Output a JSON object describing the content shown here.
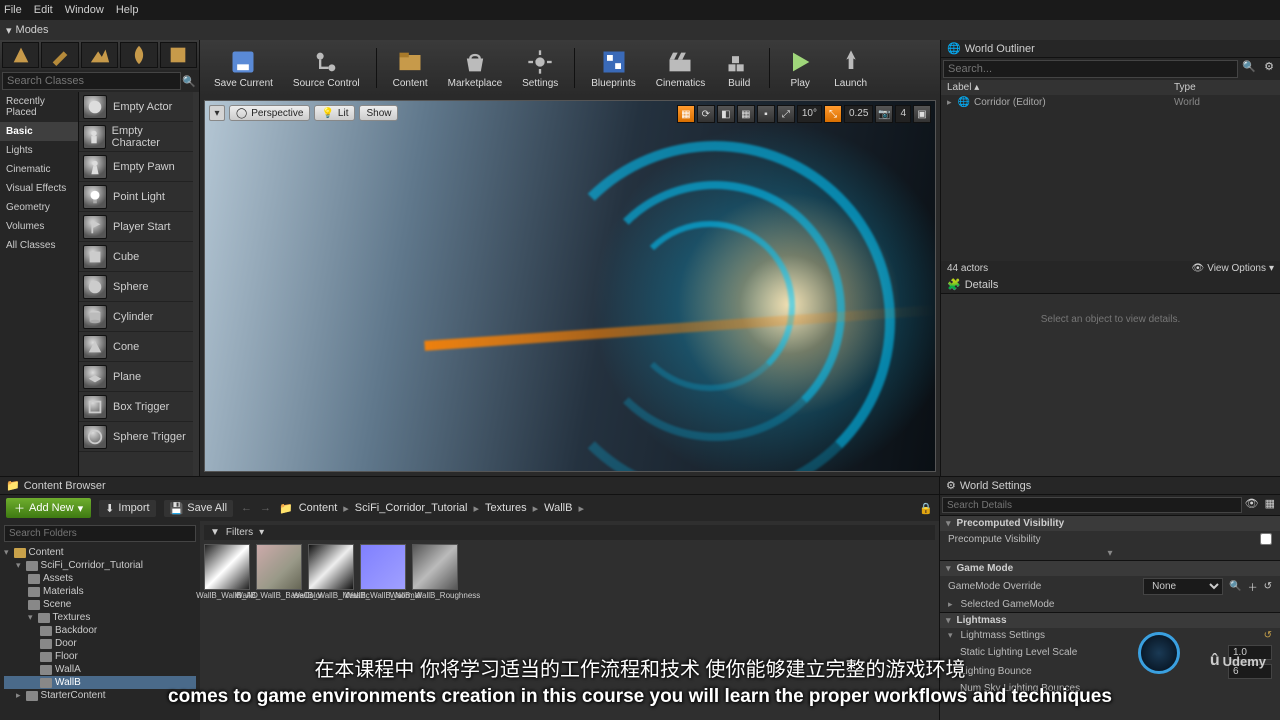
{
  "menu": [
    "File",
    "Edit",
    "Window",
    "Help"
  ],
  "modes_label": "Modes",
  "place": {
    "search_placeholder": "Search Classes",
    "categories": [
      "Recently Placed",
      "Basic",
      "Lights",
      "Cinematic",
      "Visual Effects",
      "Geometry",
      "Volumes",
      "All Classes"
    ],
    "selected_category": "Basic",
    "items": [
      "Empty Actor",
      "Empty Character",
      "Empty Pawn",
      "Point Light",
      "Player Start",
      "Cube",
      "Sphere",
      "Cylinder",
      "Cone",
      "Plane",
      "Box Trigger",
      "Sphere Trigger"
    ]
  },
  "toolbar": [
    {
      "id": "save",
      "label": "Save Current"
    },
    {
      "id": "source",
      "label": "Source Control"
    },
    {
      "id": "content",
      "label": "Content"
    },
    {
      "id": "market",
      "label": "Marketplace"
    },
    {
      "id": "settings",
      "label": "Settings"
    },
    {
      "id": "blueprints",
      "label": "Blueprints"
    },
    {
      "id": "cinematics",
      "label": "Cinematics"
    },
    {
      "id": "build",
      "label": "Build"
    },
    {
      "id": "play",
      "label": "Play"
    },
    {
      "id": "launch",
      "label": "Launch"
    }
  ],
  "viewport": {
    "buttons": [
      "Perspective",
      "Lit",
      "Show"
    ],
    "snap_angle": "10°",
    "snap_scale": "0.25",
    "cam_speed": "4"
  },
  "outliner": {
    "title": "World Outliner",
    "search_placeholder": "Search...",
    "col_label": "Label",
    "col_type": "Type",
    "rows": [
      {
        "label": "Corridor (Editor)",
        "type": "World"
      }
    ],
    "actor_count": "44 actors",
    "view_options": "View Options"
  },
  "details": {
    "title": "Details",
    "empty": "Select an object to view details."
  },
  "cb": {
    "title": "Content Browser",
    "add_new": "Add New",
    "import": "Import",
    "save_all": "Save All",
    "path_root": "Content",
    "breadcrumb": [
      "Content",
      "SciFi_Corridor_Tutorial",
      "Textures",
      "WallB"
    ],
    "filters": "Filters",
    "search_folders": "Search Folders",
    "tree": [
      {
        "name": "Content",
        "depth": 0,
        "exp": true
      },
      {
        "name": "SciFi_Corridor_Tutorial",
        "depth": 1,
        "exp": true
      },
      {
        "name": "Assets",
        "depth": 2
      },
      {
        "name": "Materials",
        "depth": 2
      },
      {
        "name": "Scene",
        "depth": 2
      },
      {
        "name": "Textures",
        "depth": 2,
        "exp": true
      },
      {
        "name": "Backdoor",
        "depth": 3
      },
      {
        "name": "Door",
        "depth": 3
      },
      {
        "name": "Floor",
        "depth": 3
      },
      {
        "name": "WallA",
        "depth": 3
      },
      {
        "name": "WallB",
        "depth": 3,
        "sel": true
      },
      {
        "name": "StarterContent",
        "depth": 1
      }
    ],
    "assets": [
      {
        "name": "WallB_WallB_AO",
        "cls": "ao"
      },
      {
        "name": "WallB_WallB_BaseColor",
        "cls": "bc"
      },
      {
        "name": "WallB_WallB_Metallic",
        "cls": "mt"
      },
      {
        "name": "WallB_WallB_Normal",
        "cls": "nm2"
      },
      {
        "name": "WallB_WallB_Roughness",
        "cls": "rg"
      }
    ]
  },
  "ws": {
    "title": "World Settings",
    "search_placeholder": "Search Details",
    "sections": {
      "precomp": "Precomputed Visibility",
      "precomp_row": "Precompute Visibility",
      "gamemode": "Game Mode",
      "gamemode_override": "GameMode Override",
      "gamemode_value": "None",
      "selected_gm": "Selected GameMode",
      "lightmass": "Lightmass",
      "lightmass_settings": "Lightmass Settings",
      "static_scale_lbl": "Static Lighting Level Scale",
      "static_scale_val": "1.0",
      "bounce_lbl": "Lighting Bounce",
      "bounce_val": "6",
      "sky_bounce_lbl": "Num Sky Lighting Bounces"
    }
  },
  "subtitle_cn": "在本课程中 你将学习适当的工作流程和技术 使你能够建立完整的游戏环境",
  "subtitle_en": "comes to game environments creation in this course you will learn the proper workflows and techniques",
  "udemy": "Udemy"
}
